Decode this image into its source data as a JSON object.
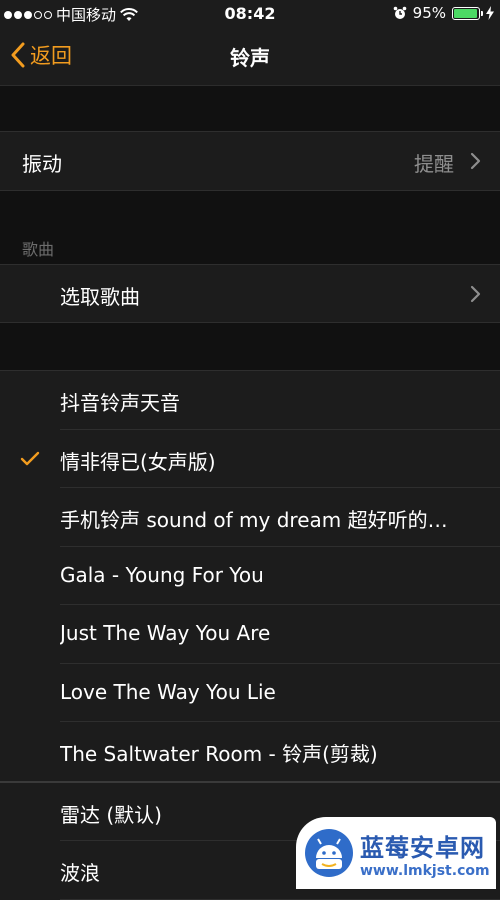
{
  "status_bar": {
    "carrier": "中国移动",
    "time": "08:42",
    "battery_percent": "95%",
    "battery_level": 0.95
  },
  "nav": {
    "back_label": "返回",
    "title": "铃声"
  },
  "vibration": {
    "label": "振动",
    "value": "提醒"
  },
  "songs_section": {
    "header": "歌曲",
    "pick_label": "选取歌曲"
  },
  "ringtones": [
    {
      "label": "抖音铃声天音",
      "checked": false
    },
    {
      "label": "情非得已(女声版)",
      "checked": true
    },
    {
      "label": "手机铃声 sound of my dream 超好听的…",
      "checked": false
    },
    {
      "label": "Gala - Young For You",
      "checked": false
    },
    {
      "label": "Just The Way You Are",
      "checked": false
    },
    {
      "label": "Love The Way You Lie",
      "checked": false
    },
    {
      "label": "The Saltwater Room - 铃声(剪裁)",
      "checked": false
    }
  ],
  "builtin_tones": [
    {
      "label": "雷达 (默认)"
    },
    {
      "label": "波浪"
    }
  ],
  "watermark": {
    "title": "蓝莓安卓网",
    "url": "www.lmkjst.com"
  },
  "colors": {
    "accent": "#f29c1f",
    "background": "#111111",
    "row": "#1c1c1c"
  }
}
